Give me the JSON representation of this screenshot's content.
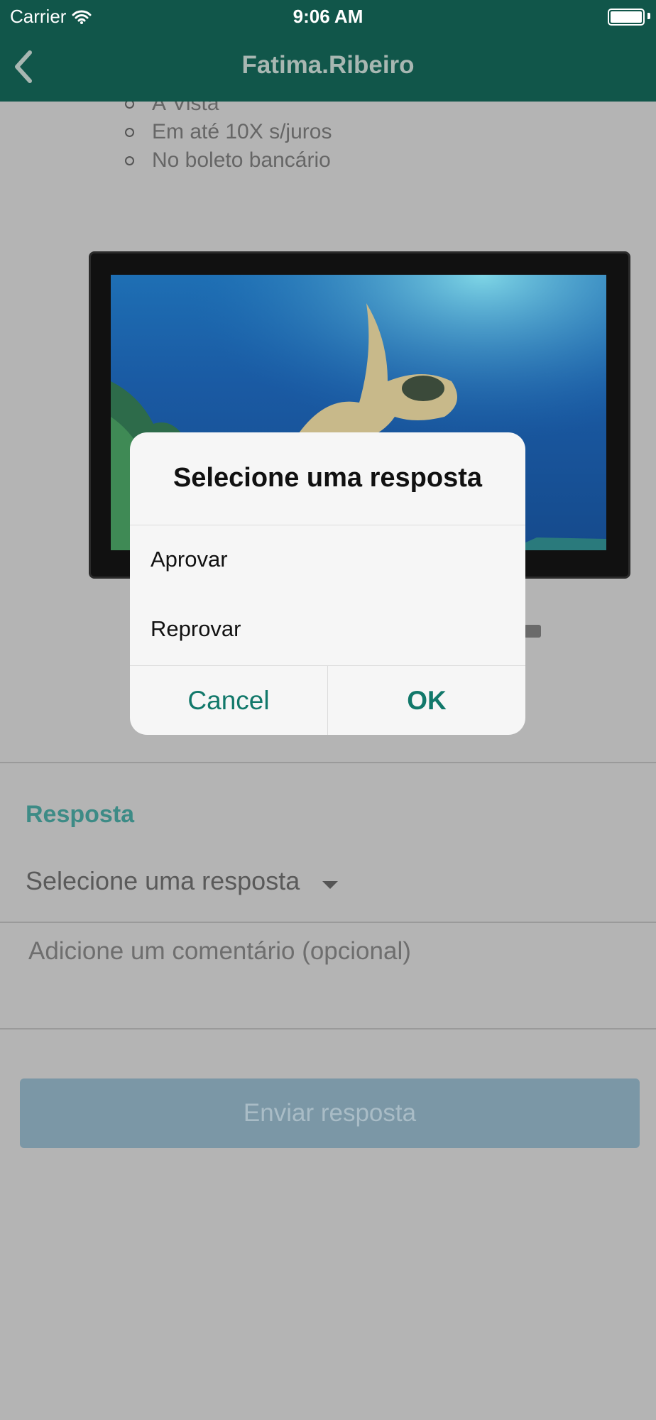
{
  "status": {
    "carrier": "Carrier",
    "time": "9:06 AM"
  },
  "nav": {
    "title": "Fatima.Ribeiro"
  },
  "payment_options": [
    "À Vista",
    "Em até 10X s/juros",
    "No boleto bancário"
  ],
  "form": {
    "section_label": "Resposta",
    "select_value": "Selecione uma resposta",
    "comment_placeholder": "Adicione um comentário (opcional)",
    "submit_label": "Enviar resposta"
  },
  "dialog": {
    "title": "Selecione uma resposta",
    "options": [
      "Aprovar",
      "Reprovar"
    ],
    "cancel_label": "Cancel",
    "ok_label": "OK"
  },
  "colors": {
    "nav_bg": "#11564a",
    "accent": "#11786a",
    "label_teal": "#3d8b86",
    "button_disabled": "#7b97a6"
  }
}
